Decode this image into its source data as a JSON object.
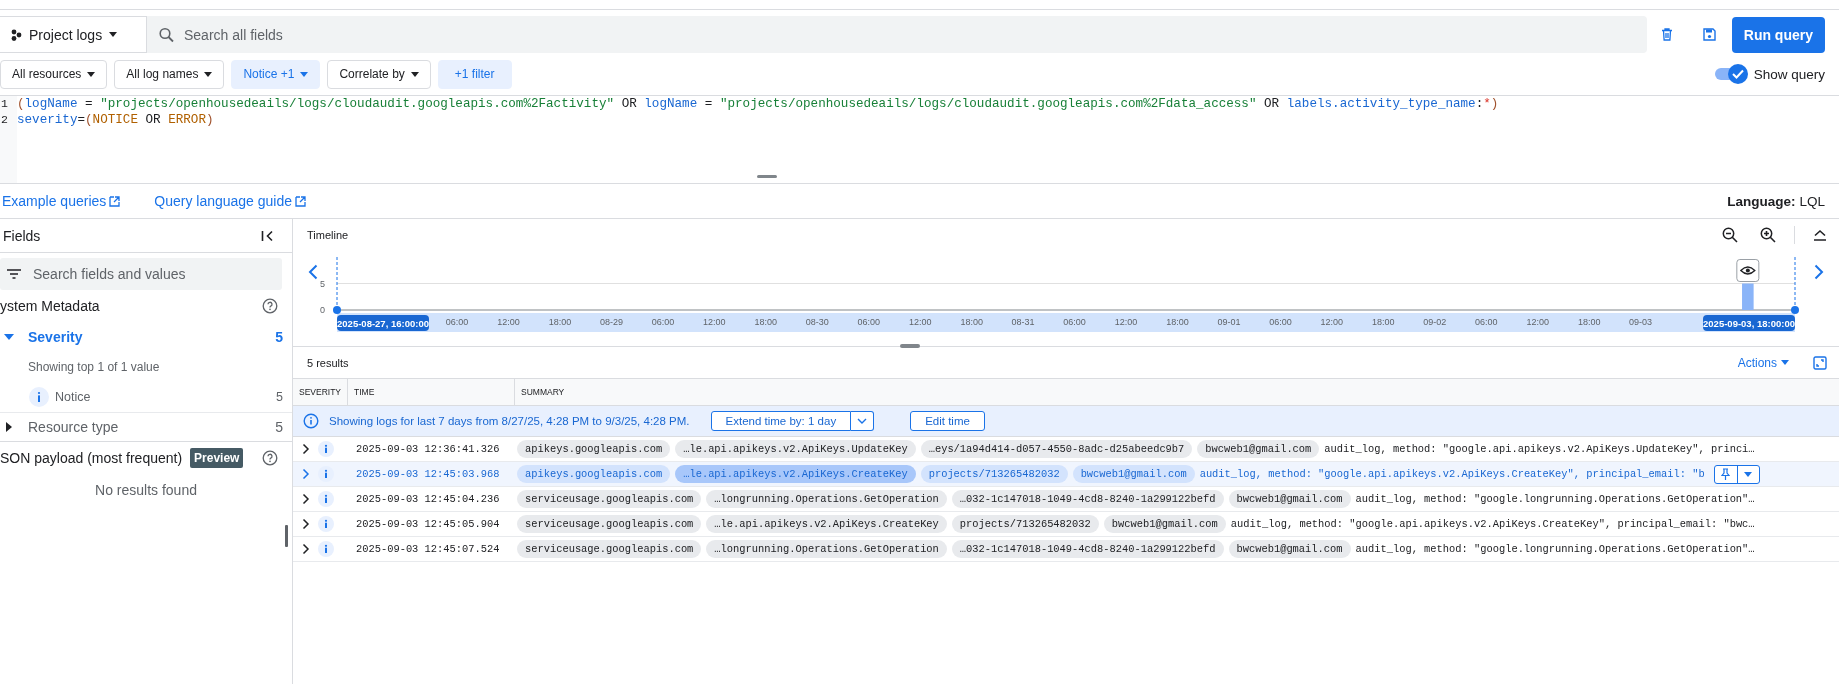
{
  "toolbar": {
    "scope": "Project logs",
    "search": {
      "placeholder": "Search all fields"
    },
    "run_button": "Run query"
  },
  "filters": [
    {
      "label": "All resources",
      "kind": "dropdown",
      "active": false
    },
    {
      "label": "All log names",
      "kind": "dropdown",
      "active": false
    },
    {
      "label": "Notice +1",
      "kind": "dropdown",
      "active": true
    },
    {
      "label": "Correlate by",
      "kind": "dropdown",
      "active": false
    },
    {
      "label": "+1 filter",
      "kind": "button",
      "active": true
    }
  ],
  "show_query": {
    "label": "Show query",
    "on": true
  },
  "query": {
    "lines": [
      {
        "number": "1",
        "tokens": [
          {
            "t": "(",
            "kind": "punct"
          },
          {
            "t": "logName",
            "kind": "field"
          },
          {
            "t": " = ",
            "kind": "op"
          },
          {
            "t": "\"projects/openhousedeails/logs/cloudaudit.googleapis.com%2Factivity\"",
            "kind": "string"
          },
          {
            "t": " OR ",
            "kind": "op"
          },
          {
            "t": "logName",
            "kind": "field"
          },
          {
            "t": " = ",
            "kind": "op"
          },
          {
            "t": "\"projects/openhousedeails/logs/cloudaudit.googleapis.com%2Fdata_access\"",
            "kind": "string"
          },
          {
            "t": " OR ",
            "kind": "op"
          },
          {
            "t": "labels.activity_type_name",
            "kind": "field"
          },
          {
            "t": ":",
            "kind": "op"
          },
          {
            "t": "*",
            "kind": "star"
          },
          {
            "t": ")",
            "kind": "punct"
          }
        ]
      },
      {
        "number": "2",
        "tokens": [
          {
            "t": "severity",
            "kind": "field"
          },
          {
            "t": "=",
            "kind": "op"
          },
          {
            "t": "(",
            "kind": "punct"
          },
          {
            "t": "NOTICE",
            "kind": "value"
          },
          {
            "t": " OR ",
            "kind": "op"
          },
          {
            "t": "ERROR",
            "kind": "value"
          },
          {
            "t": ")",
            "kind": "punct"
          }
        ]
      }
    ]
  },
  "links": [
    {
      "label": "Example queries"
    },
    {
      "label": "Query language guide"
    }
  ],
  "language": {
    "label": "Language:",
    "value": "LQL"
  },
  "fields_panel": {
    "title": "Fields",
    "search": {
      "placeholder": "Search fields and values"
    },
    "sections": [
      {
        "title": "ystem Metadata",
        "fields": [
          {
            "name": "Severity",
            "count": "5",
            "expanded": true,
            "note": "Showing top 1 of 1 value",
            "values": [
              {
                "label": "Notice",
                "count": "5"
              }
            ]
          },
          {
            "name": "Resource type",
            "count": "5",
            "expanded": false
          }
        ]
      },
      {
        "title": "SON payload (most frequent)",
        "badge": "Preview",
        "empty_text": "No results found"
      }
    ]
  },
  "timeline": {
    "title": "Timeline",
    "range_start": "2025-08-27, 16:00:00",
    "range_end": "2025-09-03, 18:00:00",
    "chart_data": {
      "type": "bar",
      "ylim": [
        0,
        10
      ],
      "yticks": [
        0,
        5
      ],
      "categories": [
        null,
        null,
        null,
        null,
        null,
        null,
        null,
        null,
        null,
        null,
        null,
        null,
        null,
        null,
        "06:00",
        null,
        null,
        null,
        null,
        null,
        "12:00",
        null,
        null,
        null,
        null,
        null,
        "18:00",
        null,
        null,
        null,
        null,
        null,
        "08-29",
        null,
        null,
        null,
        null,
        null,
        "06:00",
        null,
        null,
        null,
        null,
        null,
        "12:00",
        null,
        null,
        null,
        null,
        null,
        "18:00",
        null,
        null,
        null,
        null,
        null,
        "08-30",
        null,
        null,
        null,
        null,
        null,
        "06:00",
        null,
        null,
        null,
        null,
        null,
        "12:00",
        null,
        null,
        null,
        null,
        null,
        "18:00",
        null,
        null,
        null,
        null,
        null,
        "08-31",
        null,
        null,
        null,
        null,
        null,
        "06:00",
        null,
        null,
        null,
        null,
        null,
        "12:00",
        null,
        null,
        null,
        null,
        null,
        "18:00",
        null,
        null,
        null,
        null,
        null,
        "09-01",
        null,
        null,
        null,
        null,
        null,
        "06:00",
        null,
        null,
        null,
        null,
        null,
        "12:00",
        null,
        null,
        null,
        null,
        null,
        "18:00",
        null,
        null,
        null,
        null,
        null,
        "09-02",
        null,
        null,
        null,
        null,
        null,
        "06:00",
        null,
        null,
        null,
        null,
        null,
        "12:00",
        null,
        null,
        null,
        null,
        null,
        "18:00",
        null,
        null,
        null,
        null,
        null,
        "09-03",
        null,
        null,
        null,
        null,
        null,
        null,
        null,
        null,
        null,
        null,
        null,
        null,
        null,
        null,
        null,
        null,
        null
      ],
      "values": [
        0,
        0,
        0,
        0,
        0,
        0,
        0,
        0,
        0,
        0,
        0,
        0,
        0,
        0,
        0,
        0,
        0,
        0,
        0,
        0,
        0,
        0,
        0,
        0,
        0,
        0,
        0,
        0,
        0,
        0,
        0,
        0,
        0,
        0,
        0,
        0,
        0,
        0,
        0,
        0,
        0,
        0,
        0,
        0,
        0,
        0,
        0,
        0,
        0,
        0,
        0,
        0,
        0,
        0,
        0,
        0,
        0,
        0,
        0,
        0,
        0,
        0,
        0,
        0,
        0,
        0,
        0,
        0,
        0,
        0,
        0,
        0,
        0,
        0,
        0,
        0,
        0,
        0,
        0,
        0,
        0,
        0,
        0,
        0,
        0,
        0,
        0,
        0,
        0,
        0,
        0,
        0,
        0,
        0,
        0,
        0,
        0,
        0,
        0,
        0,
        0,
        0,
        0,
        0,
        0,
        0,
        0,
        0,
        0,
        0,
        0,
        0,
        0,
        0,
        0,
        0,
        0,
        0,
        0,
        0,
        0,
        0,
        0,
        0,
        0,
        0,
        0,
        0,
        0,
        0,
        0,
        0,
        0,
        0,
        0,
        0,
        0,
        0,
        0,
        0,
        0,
        0,
        0,
        0,
        0,
        0,
        0,
        0,
        0,
        0,
        0,
        0,
        0,
        0,
        0,
        0,
        0,
        0,
        0,
        0,
        0,
        0,
        0,
        0,
        5,
        0,
        0,
        0,
        0,
        0
      ]
    }
  },
  "results": {
    "count": "5 results",
    "actions": "Actions"
  },
  "table": {
    "columns": [
      "SEVERITY",
      "TIME",
      "SUMMARY"
    ],
    "banner": {
      "text": "Showing logs for last 7 days from 8/27/25, 4:28 PM to 9/3/25, 4:28 PM.",
      "extend_button": "Extend time by: 1 day",
      "edit_button": "Edit time"
    },
    "rows": [
      {
        "time": "2025-09-03 12:36:41.326",
        "selected": false,
        "chips": [
          {
            "text": "apikeys.googleapis.com",
            "highlighted": false
          },
          {
            "text": "…le.api.apikeys.v2.ApiKeys.UpdateKey",
            "highlighted": false
          },
          {
            "text": "…eys/1a94d414-d057-4550-8adc-d25abeedc9b7",
            "highlighted": false
          },
          {
            "text": "bwcweb1@gmail.com",
            "highlighted": false
          }
        ],
        "summary": "audit_log, method: \"google.api.apikeys.v2.ApiKeys.UpdateKey\", princi…"
      },
      {
        "time": "2025-09-03 12:45:03.968",
        "selected": true,
        "chips": [
          {
            "text": "apikeys.googleapis.com",
            "highlighted": false
          },
          {
            "text": "…le.api.apikeys.v2.ApiKeys.CreateKey",
            "highlighted": true
          },
          {
            "text": "projects/713265482032",
            "highlighted": false
          },
          {
            "text": "bwcweb1@gmail.com",
            "highlighted": false
          }
        ],
        "summary": "audit_log, method: \"google.api.apikeys.v2.ApiKeys.CreateKey\", principal_email: \"b"
      },
      {
        "time": "2025-09-03 12:45:04.236",
        "selected": false,
        "chips": [
          {
            "text": "serviceusage.googleapis.com",
            "highlighted": false
          },
          {
            "text": "…longrunning.Operations.GetOperation",
            "highlighted": false
          },
          {
            "text": "…032-1c147018-1049-4cd8-8240-1a299122befd",
            "highlighted": false
          },
          {
            "text": "bwcweb1@gmail.com",
            "highlighted": false
          }
        ],
        "summary": "audit_log, method: \"google.longrunning.Operations.GetOperation\"…"
      },
      {
        "time": "2025-09-03 12:45:05.904",
        "selected": false,
        "chips": [
          {
            "text": "serviceusage.googleapis.com",
            "highlighted": false
          },
          {
            "text": "…le.api.apikeys.v2.ApiKeys.CreateKey",
            "highlighted": false
          },
          {
            "text": "projects/713265482032",
            "highlighted": false
          },
          {
            "text": "bwcweb1@gmail.com",
            "highlighted": false
          }
        ],
        "summary": "audit_log, method: \"google.api.apikeys.v2.ApiKeys.CreateKey\", principal_email: \"bwc…"
      },
      {
        "time": "2025-09-03 12:45:07.524",
        "selected": false,
        "chips": [
          {
            "text": "serviceusage.googleapis.com",
            "highlighted": false
          },
          {
            "text": "…longrunning.Operations.GetOperation",
            "highlighted": false
          },
          {
            "text": "…032-1c147018-1049-4cd8-8240-1a299122befd",
            "highlighted": false
          },
          {
            "text": "bwcweb1@gmail.com",
            "highlighted": false
          }
        ],
        "summary": "audit_log, method: \"google.longrunning.Operations.GetOperation\"…"
      }
    ]
  }
}
